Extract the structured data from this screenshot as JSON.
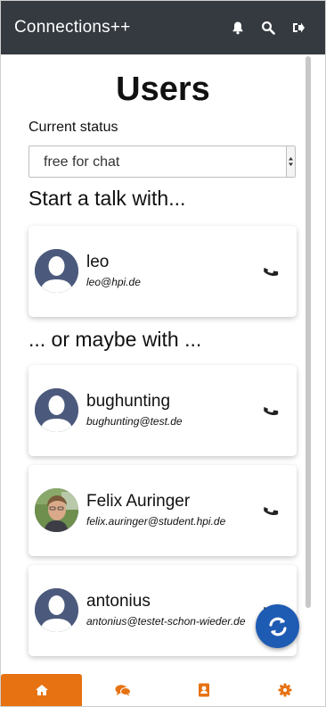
{
  "app": {
    "title": "Connections++"
  },
  "header_icons": [
    "bell-icon",
    "search-icon",
    "logout-icon"
  ],
  "page": {
    "title": "Users"
  },
  "status": {
    "label": "Current status",
    "selected": "free for chat"
  },
  "sections": {
    "start": "Start a talk with...",
    "maybe": "... or maybe with ..."
  },
  "primary_contact": {
    "name": "leo",
    "email": "leo@hpi.de",
    "avatar": "default-avatar"
  },
  "other_contacts": [
    {
      "name": "bughunting",
      "email": "bughunting@test.de",
      "avatar": "default-avatar"
    },
    {
      "name": "Felix Auringer",
      "email": "felix.auringer@student.hpi.de",
      "avatar": "photo-avatar"
    },
    {
      "name": "antonius",
      "email": "antonius@testet-schon-wieder.de",
      "avatar": "default-avatar"
    }
  ],
  "bottom_nav": [
    {
      "icon": "home-icon",
      "active": true
    },
    {
      "icon": "chat-icon",
      "active": false
    },
    {
      "icon": "contacts-icon",
      "active": false
    },
    {
      "icon": "settings-icon",
      "active": false
    }
  ],
  "colors": {
    "header": "#343a40",
    "accent": "#e67212",
    "fab": "#1e5bb3",
    "avatar": "#4b5a7c"
  }
}
